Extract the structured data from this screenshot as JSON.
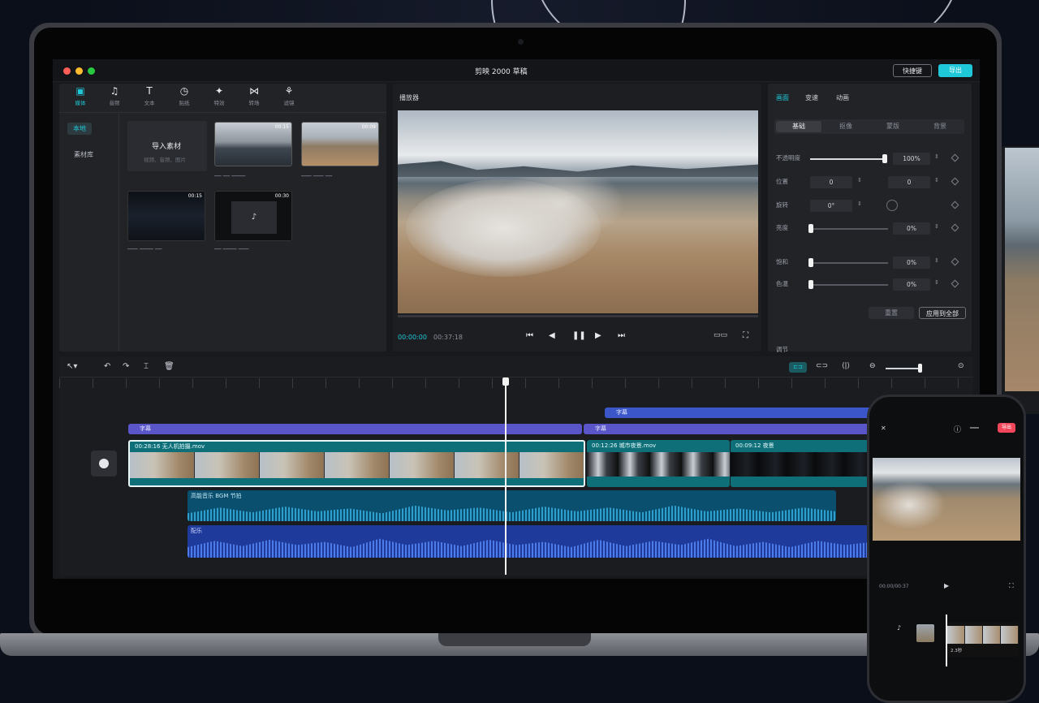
{
  "app": {
    "title": "剪映 2000 草稿",
    "export_label": "导出",
    "shortcut_label": "快捷键"
  },
  "toolbar": {
    "items": [
      {
        "label": "媒体",
        "icon": "media-icon"
      },
      {
        "label": "音频",
        "icon": "audio-icon"
      },
      {
        "label": "文本",
        "icon": "text-icon"
      },
      {
        "label": "贴纸",
        "icon": "sticker-icon"
      },
      {
        "label": "特效",
        "icon": "effects-icon"
      },
      {
        "label": "转场",
        "icon": "transition-icon"
      },
      {
        "label": "滤镜",
        "icon": "filter-icon"
      }
    ]
  },
  "media": {
    "sidebar": [
      "本地",
      "素材库"
    ],
    "import_label": "导入素材",
    "import_sub": "视频、音频、图片",
    "clips": [
      {
        "duration": "00:15"
      },
      {
        "duration": "00:09"
      },
      {
        "duration": "00:15"
      },
      {
        "duration": "00:30"
      }
    ]
  },
  "player": {
    "title": "播放器",
    "current_time": "00:00:00",
    "total_time": "00:37:18"
  },
  "inspector": {
    "tabs": [
      "画面",
      "变速",
      "动画"
    ],
    "subtabs": [
      "基础",
      "抠像",
      "蒙版",
      "背景"
    ],
    "props": [
      {
        "label": "不透明度",
        "value": "100%"
      },
      {
        "label": "位置",
        "x": "0",
        "y": "0"
      },
      {
        "label": "旋转",
        "value": "0°"
      },
      {
        "label": "亮度",
        "value": "0%"
      },
      {
        "label": "饱和",
        "value": "0%"
      },
      {
        "label": "色温",
        "value": "0%"
      }
    ],
    "reset_label": "重置",
    "apply_all_label": "应用到全部",
    "footer_label": "调节"
  },
  "timeline": {
    "text_track_1": "字幕",
    "text_track_2": "字幕",
    "text_track_3": "字幕",
    "clip_1_label": "00:28:16 无人机拍摄.mov",
    "clip_2_label": "00:12:26 城市夜景.mov",
    "clip_3_label": "00:09:12 夜景",
    "audio_1_label": "高能音乐 BGM 节拍",
    "audio_2_label": "配乐"
  },
  "phone": {
    "export_label": "导出",
    "time": "00:00/00:37",
    "clip_label": "2.3秒"
  },
  "colors": {
    "accent": "#1ec8d8",
    "teal_track": "#0e6f78",
    "purple_track": "#5a55c8",
    "blue_track": "#3b56c9"
  }
}
